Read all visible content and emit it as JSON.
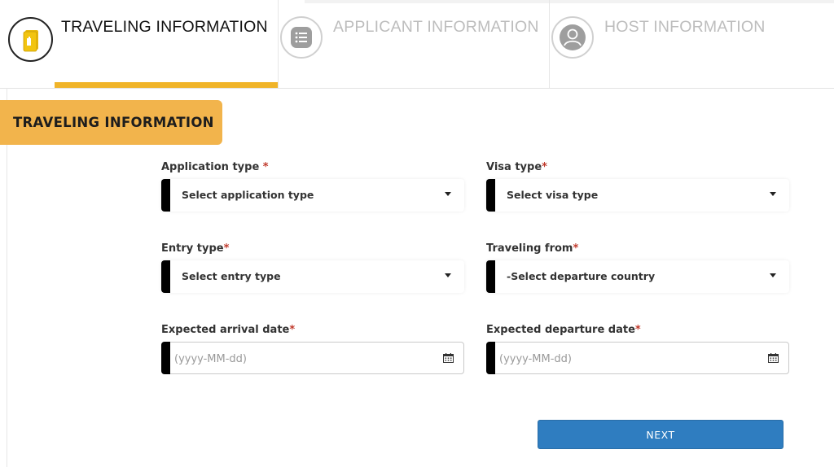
{
  "tabs": [
    {
      "label": "TRAVELING INFORMATION",
      "icon": "passport-icon",
      "active": true
    },
    {
      "label": "APPLICANT INFORMATION",
      "icon": "list-icon",
      "active": false
    },
    {
      "label": "HOST INFORMATION",
      "icon": "user-icon",
      "active": false
    }
  ],
  "section": {
    "title": "TRAVELING INFORMATION"
  },
  "form": {
    "application_type": {
      "label": "Application type ",
      "required_mark": "*",
      "value": "Select application type"
    },
    "visa_type": {
      "label": "Visa type",
      "required_mark": "*",
      "value": "Select visa type"
    },
    "entry_type": {
      "label": "Entry type",
      "required_mark": "*",
      "value": "Select entry type"
    },
    "traveling_from": {
      "label": "Traveling from",
      "required_mark": "*",
      "value": "-Select departure country"
    },
    "arrival_date": {
      "label": "Expected arrival date",
      "required_mark": "*",
      "placeholder": "(yyyy-MM-dd)",
      "value": ""
    },
    "departure_date": {
      "label": "Expected departure date",
      "required_mark": "*",
      "placeholder": "(yyyy-MM-dd)",
      "value": ""
    }
  },
  "actions": {
    "next_label": "NEXT"
  },
  "colors": {
    "accent": "#f0b429",
    "banner": "#f2b44c",
    "primary_button": "#2f7dc0",
    "required": "#c0392b"
  }
}
